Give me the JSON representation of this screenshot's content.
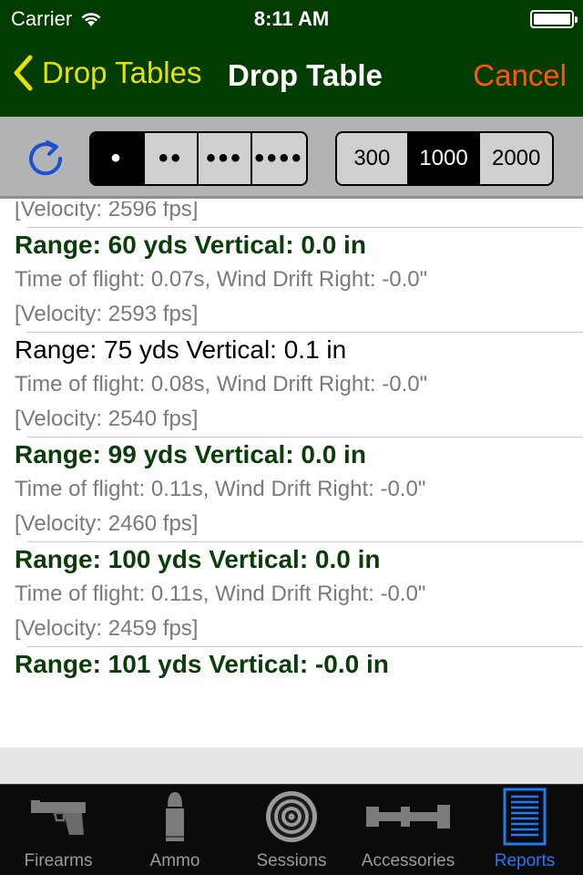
{
  "status_bar": {
    "carrier": "Carrier",
    "time": "8:11 AM"
  },
  "nav": {
    "back_label": "Drop Tables",
    "title": "Drop Table",
    "cancel_label": "Cancel"
  },
  "toolbar": {
    "dots_segments": [
      "•",
      "••",
      "•••",
      "••••"
    ],
    "dots_selected_index": 0,
    "range_segments": [
      "300",
      "1000",
      "2000"
    ],
    "range_selected_index": 1
  },
  "rows": [
    {
      "velocity": "[Velocity: 2596 fps]"
    },
    {
      "title": "Range: 60 yds Vertical: 0.0 in",
      "highlight": true,
      "detail": "Time of flight: 0.07s, Wind Drift Right: -0.0\"",
      "velocity": "[Velocity: 2593 fps]"
    },
    {
      "title": "Range: 75 yds Vertical: 0.1 in",
      "highlight": false,
      "detail": "Time of flight: 0.08s, Wind Drift Right: -0.0\"",
      "velocity": "[Velocity: 2540 fps]"
    },
    {
      "title": "Range: 99 yds Vertical: 0.0 in",
      "highlight": true,
      "detail": "Time of flight: 0.11s, Wind Drift Right: -0.0\"",
      "velocity": "[Velocity: 2460 fps]"
    },
    {
      "title": "Range: 100 yds Vertical: 0.0 in",
      "highlight": true,
      "detail": "Time of flight: 0.11s, Wind Drift Right: -0.0\"",
      "velocity": "[Velocity: 2459 fps]"
    },
    {
      "title": "Range: 101 yds Vertical: -0.0 in",
      "highlight": true
    }
  ],
  "tabs": [
    {
      "label": "Firearms",
      "icon": "pistol-icon"
    },
    {
      "label": "Ammo",
      "icon": "bullet-icon"
    },
    {
      "label": "Sessions",
      "icon": "target-icon"
    },
    {
      "label": "Accessories",
      "icon": "scope-icon"
    },
    {
      "label": "Reports",
      "icon": "report-icon"
    }
  ],
  "active_tab_index": 4,
  "colors": {
    "nav_background": "#023c01",
    "back_accent": "#e6e100",
    "cancel_accent": "#ff5a00",
    "highlight_title": "#0a3d0a",
    "tab_active": "#1e7bf5"
  }
}
